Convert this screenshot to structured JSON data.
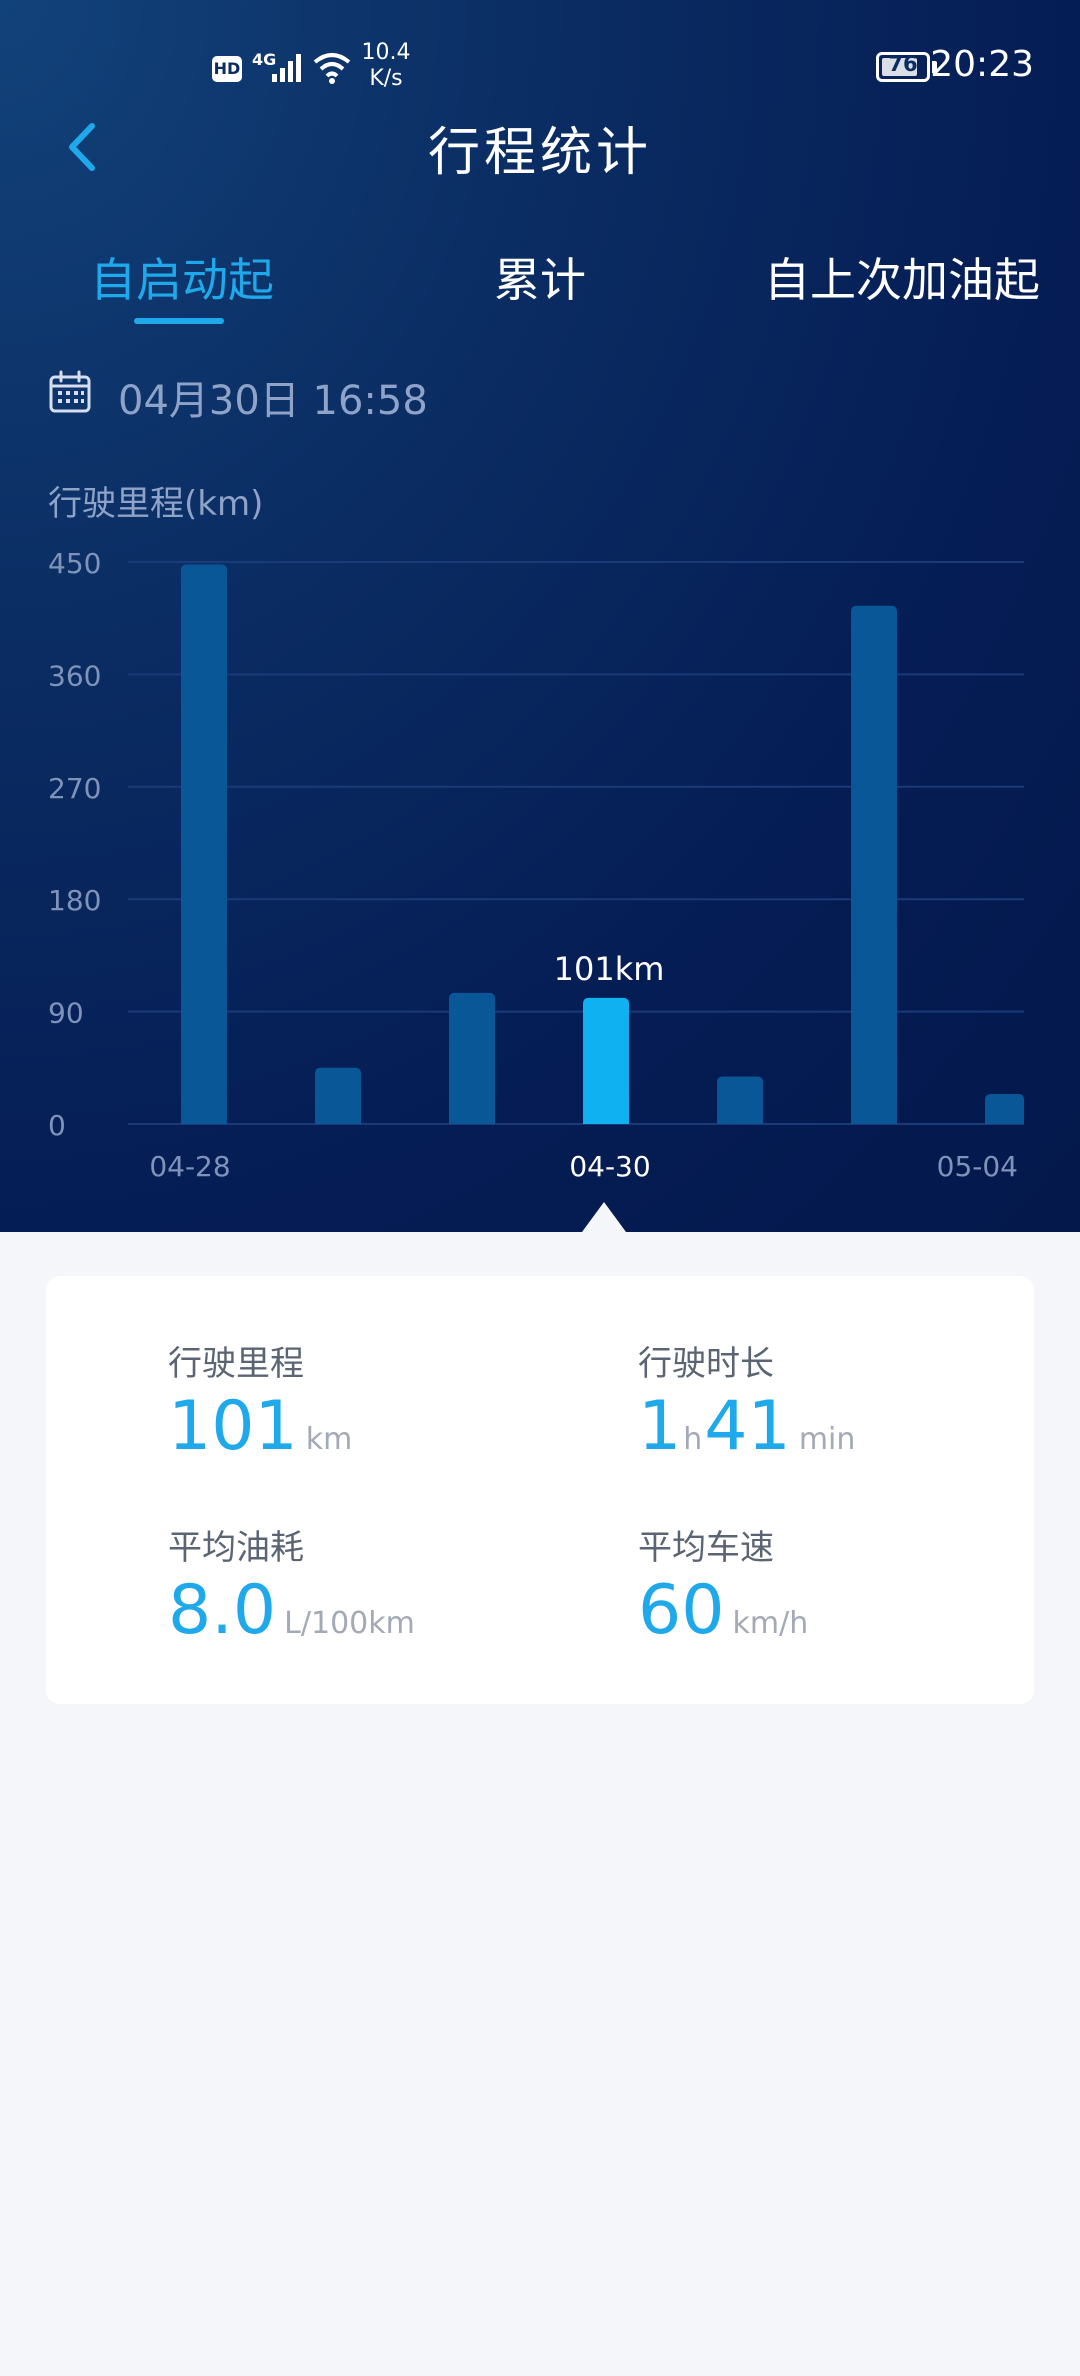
{
  "status_bar": {
    "hd": "HD",
    "net": "4G",
    "speed_value": "10.4",
    "speed_unit": "K/s",
    "battery": "76",
    "time": "20:23"
  },
  "header": {
    "title": "行程统计"
  },
  "tabs": [
    {
      "label": "自启动起",
      "active": true
    },
    {
      "label": "累计",
      "active": false
    },
    {
      "label": "自上次加油起",
      "active": false
    }
  ],
  "date": "04月30日 16:58",
  "chart_data": {
    "type": "bar",
    "ylabel": "行驶里程(km)",
    "ylim": [
      0,
      450
    ],
    "yticks": [
      0,
      90,
      180,
      270,
      360,
      450
    ],
    "categories": [
      "04-28",
      "",
      "",
      "04-30",
      "",
      "",
      "05-04"
    ],
    "values": [
      448,
      45,
      105,
      101,
      38,
      415,
      24
    ],
    "selected_index": 3,
    "selected_label": "101km",
    "x_tick_labels": [
      "04-28",
      "04-30",
      "05-04"
    ],
    "grid": true,
    "colors": {
      "bar": "#0a5797",
      "selected": "#0fb1f0",
      "grid": "#1a3a78",
      "tick": "#7f93b9"
    }
  },
  "stats": {
    "distance": {
      "label": "行驶里程",
      "value": "101",
      "unit": "km"
    },
    "duration": {
      "label": "行驶时长",
      "hours": "1",
      "hours_unit": "h",
      "minutes": "41",
      "minutes_unit": "min"
    },
    "fuel": {
      "label": "平均油耗",
      "value": "8.0",
      "unit": "L/100km"
    },
    "speed": {
      "label": "平均车速",
      "value": "60",
      "unit": "km/h"
    }
  },
  "colors": {
    "accent": "#1fa8ea",
    "bg_top": "#0a2c62",
    "bg_bottom": "#f4f6f9"
  }
}
